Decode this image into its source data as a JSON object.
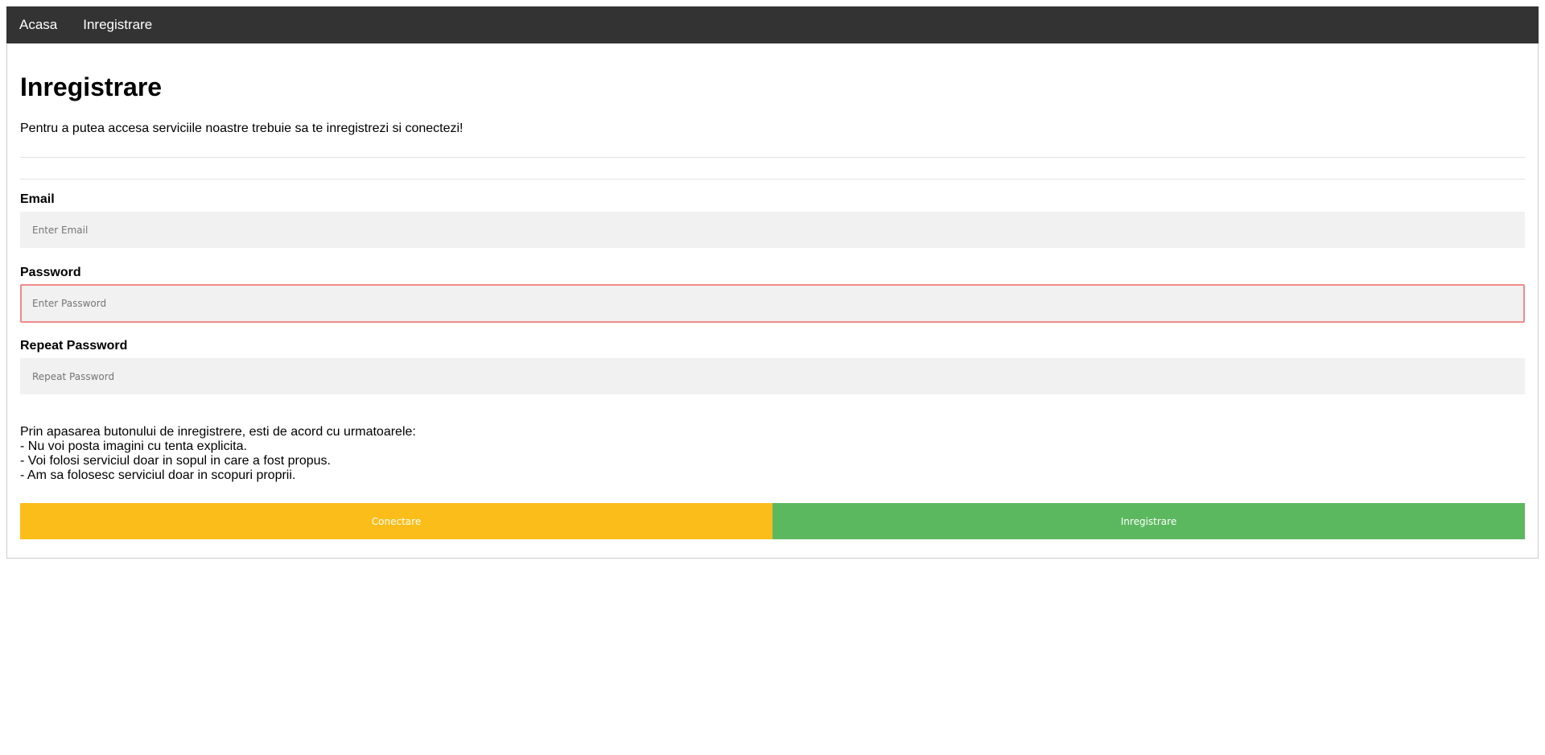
{
  "nav": {
    "items": [
      {
        "label": "Acasa"
      },
      {
        "label": "Inregistrare"
      }
    ]
  },
  "main": {
    "title": "Inregistrare",
    "subtitle": "Pentru a putea accesa serviciile noastre trebuie sa te inregistrezi si conectezi!"
  },
  "form": {
    "email": {
      "label": "Email",
      "placeholder": "Enter Email",
      "value": ""
    },
    "password": {
      "label": "Password",
      "placeholder": "Enter Password",
      "value": ""
    },
    "repeat_password": {
      "label": "Repeat Password",
      "placeholder": "Repeat Password",
      "value": ""
    }
  },
  "terms": {
    "intro": "Prin apasarea butonului de inregistrere, esti de acord cu urmatoarele:",
    "items": [
      "- Nu voi posta imagini cu tenta explicita.",
      "- Voi folosi serviciul doar in sopul in care a fost propus.",
      "- Am sa folosesc serviciul doar in scopuri proprii."
    ]
  },
  "buttons": {
    "login_label": "Conectare",
    "register_label": "Inregistrare"
  },
  "colors": {
    "nav_background": "#333333",
    "input_background": "#f1f1f1",
    "focus_border": "#f08a8a",
    "login_button": "#fbbd1a",
    "register_button": "#5cb85f"
  }
}
